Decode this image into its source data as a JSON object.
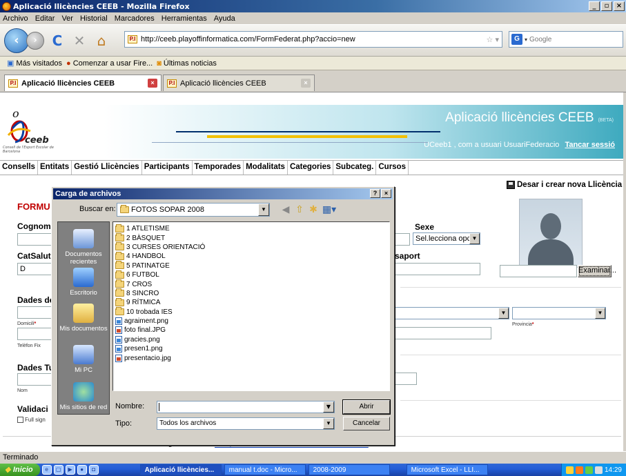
{
  "window": {
    "title": "Aplicació llicències CEEB - Mozilla Firefox",
    "btn_min": "_",
    "btn_max": "▫",
    "btn_close": "×"
  },
  "menubar": [
    "Archivo",
    "Editar",
    "Ver",
    "Historial",
    "Marcadores",
    "Herramientas",
    "Ayuda"
  ],
  "navbar": {
    "url": "http://ceeb.playoffinformatica.com/FormFederat.php?accio=new",
    "favicon": "P.I",
    "search_placeholder": "Google",
    "search_engine": "G"
  },
  "bookmarks": [
    "Más visitados",
    "Comenzar a usar Fire...",
    "Últimas noticias"
  ],
  "tabs": [
    {
      "label": "Aplicació llicències CEEB",
      "favicon": "P.I"
    },
    {
      "label": "Aplicació llicències CEEB",
      "favicon": "P.I"
    }
  ],
  "header": {
    "title": "Aplicació llicències CEEB",
    "beta": "(BETA)",
    "user_text": "UCeeb1 , com a usuari UsuariFederacio",
    "logout": "Tancar sessió",
    "logo_text": "ceeb",
    "logo_sub": "Consell de l'Esport Escolar de Barcelona"
  },
  "mainmenu": [
    "Consells",
    "Entitats",
    "Gestió Llicències",
    "Participants",
    "Temporades",
    "Modalitats",
    "Categories",
    "Subcateg.",
    "Cursos"
  ],
  "form": {
    "save_label": "Desar i crear nova Llicència",
    "title": "FORMU",
    "cognom": "Cognom",
    "sexe": "Sexe",
    "sexe_value": "Sel.lecciona opc",
    "catsalut": "CatSalut",
    "catsalut_value": "D",
    "passaport": "saport",
    "dades1": "Dades de",
    "domicili": "Domicili",
    "provincia": "Provincia",
    "telefon": "Telèfon Fix",
    "dades2": "Dades Tu",
    "nom": "Nom",
    "validacio": "Validaci",
    "full_sign": "Full sign",
    "examinar": "Examinar...",
    "req": "*"
  },
  "footer": {
    "link": "CEEB, CONSELL DE L'ESPORT ESCOLAR DE BARCELONA",
    "small_o": "o"
  },
  "status": "Terminado",
  "dialog": {
    "title": "Carga de archivos",
    "help": "?",
    "close": "×",
    "look_in_label": "Buscar en:",
    "look_in_value": "FOTOS SOPAR 2008",
    "places": [
      "Documentos recientes",
      "Escritorio",
      "Mis documentos",
      "Mi PC",
      "Mis sitios de red"
    ],
    "files": [
      {
        "name": "1 ATLETISME",
        "type": "folder"
      },
      {
        "name": "2 BÀSQUET",
        "type": "folder"
      },
      {
        "name": "3 CURSES ORIENTACIÓ",
        "type": "folder"
      },
      {
        "name": "4 HANDBOL",
        "type": "folder"
      },
      {
        "name": "5 PATINATGE",
        "type": "folder"
      },
      {
        "name": "6 FUTBOL",
        "type": "folder"
      },
      {
        "name": "7 CROS",
        "type": "folder"
      },
      {
        "name": "8 SINCRO",
        "type": "folder"
      },
      {
        "name": "9 RÍTMICA",
        "type": "folder"
      },
      {
        "name": "10 trobada IES",
        "type": "folder"
      },
      {
        "name": "agraiment.png",
        "type": "png"
      },
      {
        "name": "foto final.JPG",
        "type": "jpg"
      },
      {
        "name": "gracies.png",
        "type": "png"
      },
      {
        "name": "presen1.png",
        "type": "png"
      },
      {
        "name": "presentacio.jpg",
        "type": "jpg"
      }
    ],
    "filename_label": "Nombre:",
    "filename_value": "",
    "filetype_label": "Tipo:",
    "filetype_value": "Todos los archivos",
    "open": "Abrir",
    "cancel": "Cancelar"
  },
  "taskbar": {
    "start": "Inicio",
    "tasks": [
      "Aplicació llicències...",
      "manual t.doc - Micro...",
      "2008-2009",
      "Microsoft Excel - LLI..."
    ],
    "clock": "14:29"
  }
}
